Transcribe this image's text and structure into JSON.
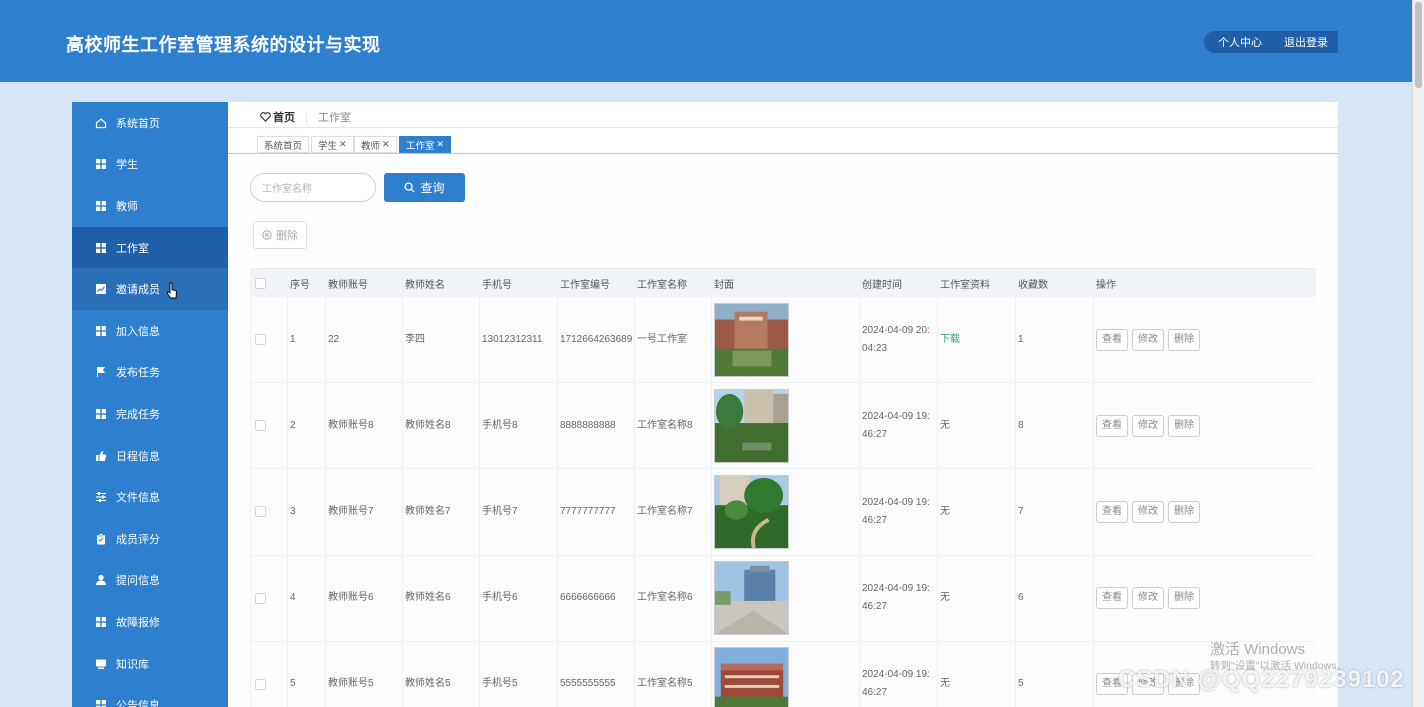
{
  "app": {
    "title": "高校师生工作室管理系统的设计与实现"
  },
  "header": {
    "personal_center": "个人中心",
    "logout": "退出登录"
  },
  "sidebar": {
    "items": [
      {
        "label": "系统首页",
        "icon": "home-icon"
      },
      {
        "label": "学生",
        "icon": "grid-icon"
      },
      {
        "label": "教师",
        "icon": "grid-icon"
      },
      {
        "label": "工作室",
        "icon": "grid-icon",
        "state": "active"
      },
      {
        "label": "邀请成员",
        "icon": "chart-icon",
        "state": "hover"
      },
      {
        "label": "加入信息",
        "icon": "grid-icon"
      },
      {
        "label": "发布任务",
        "icon": "flag-icon"
      },
      {
        "label": "完成任务",
        "icon": "grid-icon"
      },
      {
        "label": "日程信息",
        "icon": "thumb-icon"
      },
      {
        "label": "文件信息",
        "icon": "sliders-icon"
      },
      {
        "label": "成员评分",
        "icon": "clipboard-icon"
      },
      {
        "label": "提问信息",
        "icon": "user-icon"
      },
      {
        "label": "故障报修",
        "icon": "grid-icon"
      },
      {
        "label": "知识库",
        "icon": "monitor-icon"
      },
      {
        "label": "公告信息",
        "icon": "grid-icon"
      }
    ]
  },
  "breadcrumb": {
    "home": "首页",
    "separator": "⋮",
    "current": "工作室"
  },
  "tabs": [
    {
      "label": "系统首页",
      "closable": false
    },
    {
      "label": "学生",
      "closable": true
    },
    {
      "label": "教师",
      "closable": true
    },
    {
      "label": "工作室",
      "closable": true,
      "active": true
    }
  ],
  "search": {
    "placeholder": "工作室名称",
    "query_label": "查询"
  },
  "toolbar": {
    "delete_label": "删除"
  },
  "table": {
    "columns": [
      "序号",
      "教师账号",
      "教师姓名",
      "手机号",
      "工作室编号",
      "工作室名称",
      "封面",
      "创建时间",
      "工作室资料",
      "收藏数",
      "操作"
    ],
    "rows": [
      {
        "index": "1",
        "account": "22",
        "name": "李四",
        "phone": "13012312311",
        "studio_no": "1712664263689",
        "studio_name": "一号工作室",
        "created": "2024-04-09 20:04:23",
        "material": "下载",
        "favorites": "1"
      },
      {
        "index": "2",
        "account": "教师账号8",
        "name": "教师姓名8",
        "phone": "手机号8",
        "studio_no": "8888888888",
        "studio_name": "工作室名称8",
        "created": "2024-04-09 19:46:27",
        "material": "无",
        "favorites": "8"
      },
      {
        "index": "3",
        "account": "教师账号7",
        "name": "教师姓名7",
        "phone": "手机号7",
        "studio_no": "7777777777",
        "studio_name": "工作室名称7",
        "created": "2024-04-09 19:46:27",
        "material": "无",
        "favorites": "7"
      },
      {
        "index": "4",
        "account": "教师账号6",
        "name": "教师姓名6",
        "phone": "手机号6",
        "studio_no": "6666666666",
        "studio_name": "工作室名称6",
        "created": "2024-04-09 19:46:27",
        "material": "无",
        "favorites": "6"
      },
      {
        "index": "5",
        "account": "教师账号5",
        "name": "教师姓名5",
        "phone": "手机号5",
        "studio_no": "5555555555",
        "studio_name": "工作室名称5",
        "created": "2024-04-09 19:46:27",
        "material": "无",
        "favorites": "5"
      }
    ],
    "actions": {
      "view": "查看",
      "edit": "修改",
      "delete": "删除"
    }
  },
  "overlay": {
    "activate_title": "激活 Windows",
    "activate_hint": "转到\"设置\"以激活 Windows。",
    "csdn_watermark": "CSDN @QQ2279239102"
  },
  "colors": {
    "primary": "#2f7fcf",
    "primary_dark": "#1f5fa8",
    "download": "#2aa17a",
    "page_bg": "#d7e6f5"
  }
}
